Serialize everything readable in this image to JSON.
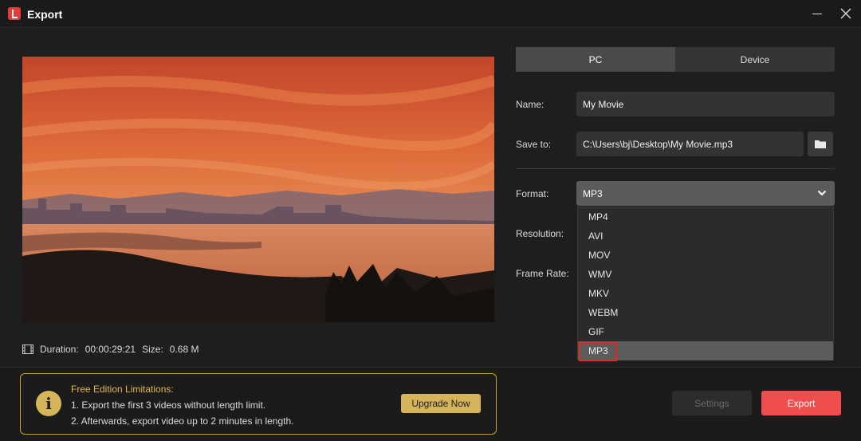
{
  "window": {
    "title": "Export"
  },
  "preview": {
    "duration_label": "Duration:",
    "duration_value": "00:00:29:21",
    "size_label": "Size:",
    "size_value": "0.68 M"
  },
  "tabs": [
    {
      "label": "PC",
      "active": true
    },
    {
      "label": "Device",
      "active": false
    }
  ],
  "form": {
    "name_label": "Name:",
    "name_value": "My Movie",
    "save_label": "Save to:",
    "save_value": "C:\\Users\\bj\\Desktop\\My Movie.mp3",
    "format_label": "Format:",
    "format_value": "MP3",
    "resolution_label": "Resolution:",
    "framerate_label": "Frame Rate:"
  },
  "format_options": [
    "MP4",
    "AVI",
    "MOV",
    "WMV",
    "MKV",
    "WEBM",
    "GIF",
    "MP3"
  ],
  "selected_format": "MP3",
  "limitations": {
    "title": "Free Edition Limitations:",
    "line1": "1. Export the first 3 videos without length limit.",
    "line2": "2. Afterwards, export video up to 2 minutes in length.",
    "upgrade_label": "Upgrade Now"
  },
  "footer": {
    "settings_label": "Settings",
    "export_label": "Export"
  },
  "colors": {
    "accent": "#f04e4e",
    "gold": "#d6b55a",
    "highlight_border": "#e02626"
  }
}
